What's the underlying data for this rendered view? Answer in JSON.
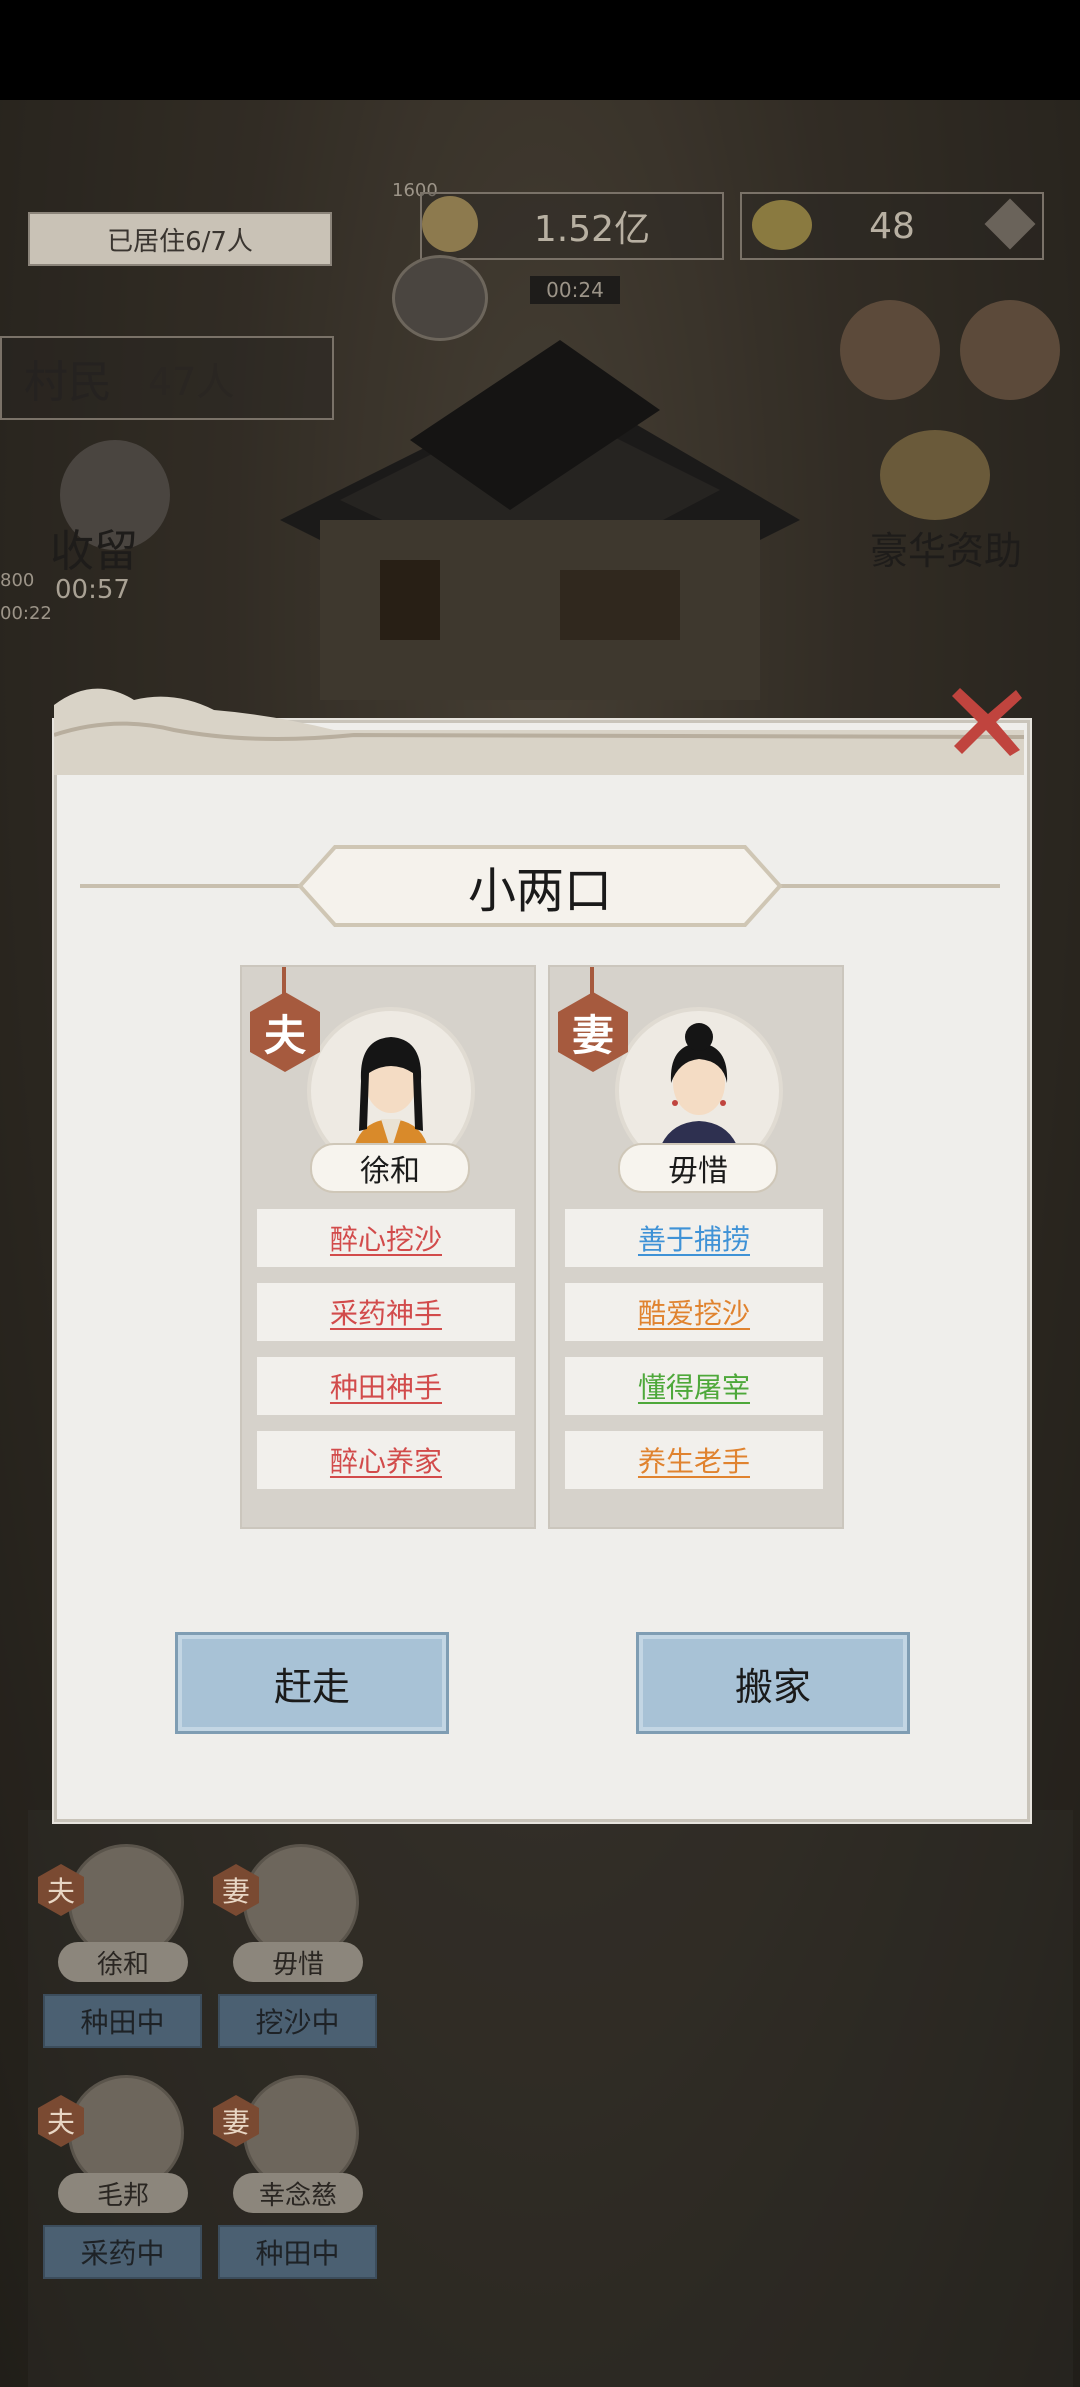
{
  "hud": {
    "residents": "已居住6/7人",
    "copper_small": "1600",
    "money": "1.52亿",
    "coins": "48",
    "timer": "00:24",
    "villagers_label": "村民",
    "villagers_count": "47人",
    "shelter_label": "收留",
    "shelter_timer": "00:57",
    "side_num": "800",
    "side_timer": "00:22",
    "luxury_label": "豪华资助"
  },
  "popup": {
    "title": "小两口",
    "husband": {
      "badge": "夫",
      "name": "徐和",
      "traits": [
        {
          "text": "醉心挖沙",
          "color": "#d24b4b"
        },
        {
          "text": "采药神手",
          "color": "#d24b4b"
        },
        {
          "text": "种田神手",
          "color": "#d24b4b"
        },
        {
          "text": "醉心养家",
          "color": "#d24b4b"
        }
      ]
    },
    "wife": {
      "badge": "妻",
      "name": "毋惜",
      "traits": [
        {
          "text": "善于捕捞",
          "color": "#3f92d6"
        },
        {
          "text": "酷爱挖沙",
          "color": "#e0832f"
        },
        {
          "text": "懂得屠宰",
          "color": "#4ea83a"
        },
        {
          "text": "养生老手",
          "color": "#e0832f"
        }
      ]
    },
    "evict_label": "赶走",
    "move_label": "搬家"
  },
  "villagers": [
    {
      "badge": "夫",
      "name": "徐和",
      "status": "种田中"
    },
    {
      "badge": "妻",
      "name": "毋惜",
      "status": "挖沙中"
    },
    {
      "badge": "夫",
      "name": "毛邦",
      "status": "采药中"
    },
    {
      "badge": "妻",
      "name": "幸念慈",
      "status": "种田中"
    }
  ]
}
